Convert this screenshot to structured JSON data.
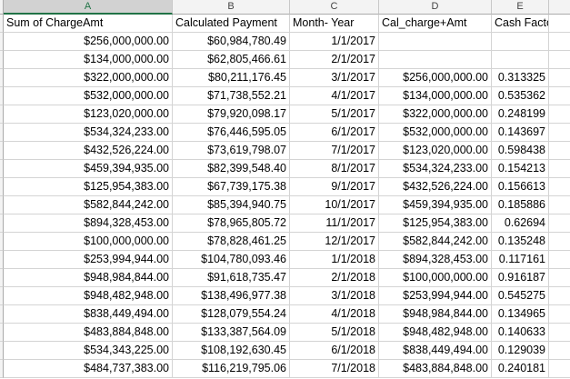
{
  "columns": [
    {
      "letter": "A",
      "selected": true
    },
    {
      "letter": "B",
      "selected": false
    },
    {
      "letter": "C",
      "selected": false
    },
    {
      "letter": "D",
      "selected": false
    },
    {
      "letter": "E",
      "selected": false
    }
  ],
  "header_row": [
    "Sum of ChargeAmt",
    "Calculated Payment",
    "Month- Year",
    "Cal_charge+Amt",
    "Cash Factor"
  ],
  "rows": [
    [
      "$256,000,000.00",
      "$60,984,780.49",
      "1/1/2017",
      "",
      ""
    ],
    [
      "$134,000,000.00",
      "$62,805,466.61",
      "2/1/2017",
      "",
      ""
    ],
    [
      "$322,000,000.00",
      "$80,211,176.45",
      "3/1/2017",
      "$256,000,000.00",
      "0.313325"
    ],
    [
      "$532,000,000.00",
      "$71,738,552.21",
      "4/1/2017",
      "$134,000,000.00",
      "0.535362"
    ],
    [
      "$123,020,000.00",
      "$79,920,098.17",
      "5/1/2017",
      "$322,000,000.00",
      "0.248199"
    ],
    [
      "$534,324,233.00",
      "$76,446,595.05",
      "6/1/2017",
      "$532,000,000.00",
      "0.143697"
    ],
    [
      "$432,526,224.00",
      "$73,619,798.07",
      "7/1/2017",
      "$123,020,000.00",
      "0.598438"
    ],
    [
      "$459,394,935.00",
      "$82,399,548.40",
      "8/1/2017",
      "$534,324,233.00",
      "0.154213"
    ],
    [
      "$125,954,383.00",
      "$67,739,175.38",
      "9/1/2017",
      "$432,526,224.00",
      "0.156613"
    ],
    [
      "$582,844,242.00",
      "$85,394,940.75",
      "10/1/2017",
      "$459,394,935.00",
      "0.185886"
    ],
    [
      "$894,328,453.00",
      "$78,965,805.72",
      "11/1/2017",
      "$125,954,383.00",
      "0.62694"
    ],
    [
      "$100,000,000.00",
      "$78,828,461.25",
      "12/1/2017",
      "$582,844,242.00",
      "0.135248"
    ],
    [
      "$253,994,944.00",
      "$104,780,093.46",
      "1/1/2018",
      "$894,328,453.00",
      "0.117161"
    ],
    [
      "$948,984,844.00",
      "$91,618,735.47",
      "2/1/2018",
      "$100,000,000.00",
      "0.916187"
    ],
    [
      "$948,482,948.00",
      "$138,496,977.38",
      "3/1/2018",
      "$253,994,944.00",
      "0.545275"
    ],
    [
      "$838,449,494.00",
      "$128,079,554.24",
      "4/1/2018",
      "$948,984,844.00",
      "0.134965"
    ],
    [
      "$483,884,848.00",
      "$133,387,564.09",
      "5/1/2018",
      "$948,482,948.00",
      "0.140633"
    ],
    [
      "$534,343,225.00",
      "$108,192,630.45",
      "6/1/2018",
      "$838,449,494.00",
      "0.129039"
    ],
    [
      "$484,737,383.00",
      "$116,219,795.06",
      "7/1/2018",
      "$483,884,848.00",
      "0.240181"
    ]
  ]
}
